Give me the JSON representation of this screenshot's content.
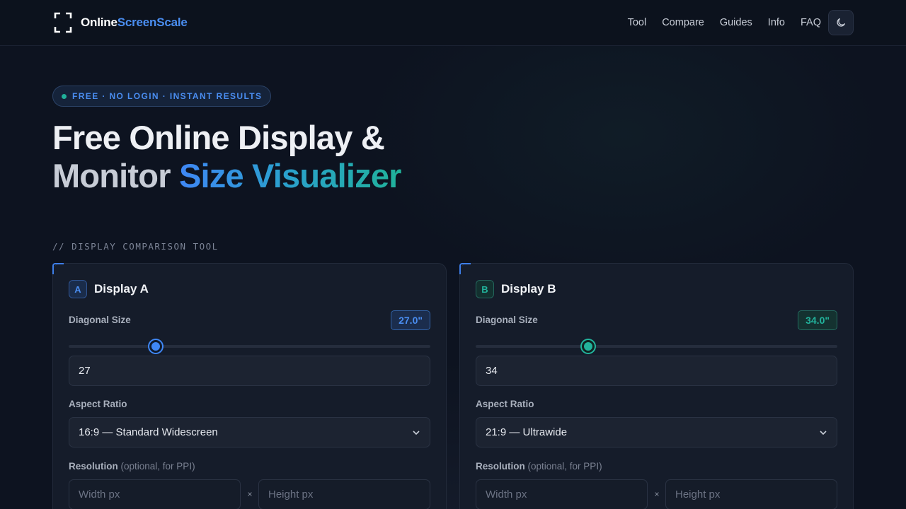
{
  "header": {
    "brand_part1": "Online",
    "brand_part2": "ScreenScale",
    "nav": [
      "Tool",
      "Compare",
      "Guides",
      "Info",
      "FAQ"
    ],
    "theme_icon": "moon-icon"
  },
  "hero": {
    "badge": "FREE · NO LOGIN · INSTANT RESULTS",
    "title_line1": "Free Online Display &",
    "title_line2_plain": "Monitor ",
    "title_line2_gradient": "Size Visualizer"
  },
  "section_label": "// DISPLAY COMPARISON TOOL",
  "displays": [
    {
      "letter": "A",
      "title": "Display A",
      "diagonal_label": "Diagonal Size",
      "diagonal_chip": "27.0\"",
      "slider_fraction": 0.241,
      "diagonal_value": "27",
      "aspect_label": "Aspect Ratio",
      "aspect_value": "16:9 — Standard Widescreen",
      "resolution_label": "Resolution",
      "resolution_hint": "(optional, for PPI)",
      "width_placeholder": "Width px",
      "height_placeholder": "Height px",
      "times": "×",
      "accent": "#3f87f5"
    },
    {
      "letter": "B",
      "title": "Display B",
      "diagonal_label": "Diagonal Size",
      "diagonal_chip": "34.0\"",
      "slider_fraction": 0.311,
      "diagonal_value": "34",
      "aspect_label": "Aspect Ratio",
      "aspect_value": "21:9 — Ultrawide",
      "resolution_label": "Resolution",
      "resolution_hint": "(optional, for PPI)",
      "width_placeholder": "Width px",
      "height_placeholder": "Height px",
      "times": "×",
      "accent": "#22b39c"
    }
  ]
}
